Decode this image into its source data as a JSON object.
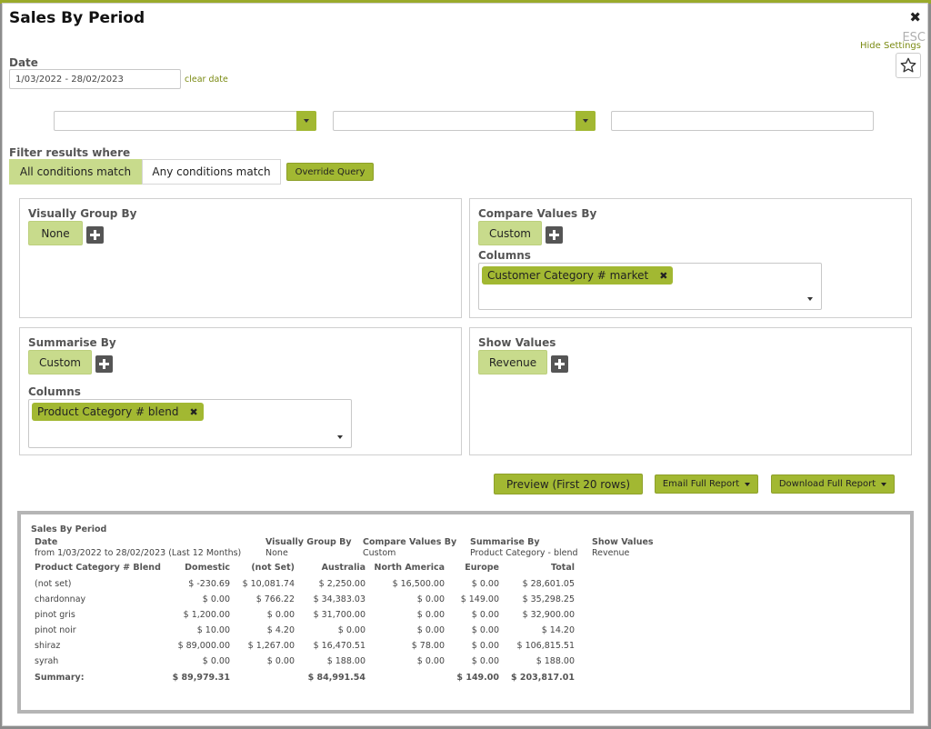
{
  "title": "Sales By Period",
  "close_glyph": "✖",
  "esc_label": "ESC",
  "hide_settings": "Hide Settings",
  "star_icon": "star-icon",
  "date": {
    "label": "Date",
    "value": "1/03/2022 - 28/02/2023",
    "clear": "clear date"
  },
  "filter": {
    "label": "Filter results where",
    "all": "All conditions match",
    "any": "Any conditions match",
    "override": "Override Query"
  },
  "panels": {
    "group": {
      "title": "Visually Group By",
      "value": "None"
    },
    "compare": {
      "title": "Compare Values By",
      "value": "Custom",
      "columns_label": "Columns",
      "columns_tag": "Customer Category # market"
    },
    "summarise": {
      "title": "Summarise By",
      "value": "Custom",
      "columns_label": "Columns",
      "columns_tag": "Product Category # blend"
    },
    "show": {
      "title": "Show Values",
      "value": "Revenue"
    }
  },
  "actions": {
    "preview": "Preview (First 20 rows)",
    "email": "Email Full Report",
    "download": "Download Full Report"
  },
  "report": {
    "title": "Sales By Period",
    "meta": [
      {
        "label": "Date",
        "value": "from 1/03/2022 to 28/02/2023 (Last 12 Months)"
      },
      {
        "label": "Visually Group By",
        "value": "None"
      },
      {
        "label": "Compare Values By",
        "value": "Custom"
      },
      {
        "label": "Summarise By",
        "value": "Product Category - blend"
      },
      {
        "label": "Show Values",
        "value": "Revenue"
      }
    ],
    "headers": [
      "Product Category # Blend",
      "Domestic",
      "(not Set)",
      "Australia",
      "North America",
      "Europe",
      "Total"
    ],
    "rows": [
      [
        "(not set)",
        "$ -230.69",
        "$ 10,081.74",
        "$ 2,250.00",
        "$ 16,500.00",
        "$ 0.00",
        "$ 28,601.05"
      ],
      [
        "chardonnay",
        "$ 0.00",
        "$ 766.22",
        "$ 34,383.03",
        "$ 0.00",
        "$ 149.00",
        "$ 35,298.25"
      ],
      [
        "pinot gris",
        "$ 1,200.00",
        "$ 0.00",
        "$ 31,700.00",
        "$ 0.00",
        "$ 0.00",
        "$ 32,900.00"
      ],
      [
        "pinot noir",
        "$ 10.00",
        "$ 4.20",
        "$ 0.00",
        "$ 0.00",
        "$ 0.00",
        "$ 14.20"
      ],
      [
        "shiraz",
        "$ 89,000.00",
        "$ 1,267.00",
        "$ 16,470.51",
        "$ 78.00",
        "$ 0.00",
        "$ 106,815.51"
      ],
      [
        "syrah",
        "$ 0.00",
        "$ 0.00",
        "$ 188.00",
        "$ 0.00",
        "$ 0.00",
        "$ 188.00"
      ]
    ],
    "summary": [
      "Summary:",
      "$ 89,979.31",
      "",
      "$ 84,991.54",
      "",
      "$ 149.00",
      "$ 203,817.01"
    ]
  }
}
